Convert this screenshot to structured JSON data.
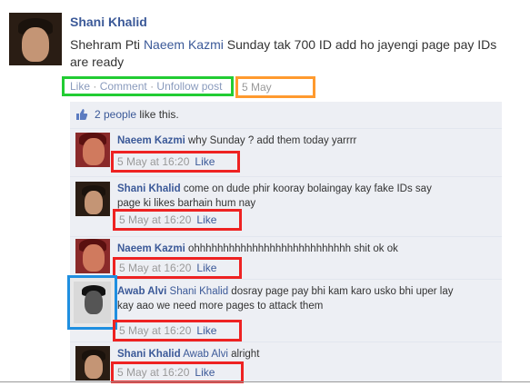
{
  "post": {
    "author": "Shani Khalid",
    "text_before": "Shehram Pti ",
    "mention": "Naeem Kazmi",
    "text_after": " Sunday tak 700 ID add ho jayengi page pay IDs are ready",
    "actions": {
      "like": "Like",
      "comment": "Comment",
      "unfollow": "Unfollow post",
      "separator": "·"
    },
    "date": "5 May"
  },
  "likes": {
    "count_link": "2 people",
    "suffix": " like this."
  },
  "comments": [
    {
      "author": "Naeem Kazmi",
      "mention": "",
      "text": "why Sunday ? add them today yarrrr",
      "time": "5 May at 16:20",
      "like": "Like"
    },
    {
      "author": "Shani Khalid",
      "mention": "",
      "text": "come on dude phir kooray bolaingay kay fake IDs say page ki likes barhain hum nay",
      "time": "5 May at 16:20",
      "like": "Like"
    },
    {
      "author": "Naeem Kazmi",
      "mention": "",
      "text": "ohhhhhhhhhhhhhhhhhhhhhhhhhhh shit ok ok",
      "time": "5 May at 16:20",
      "like": "Like"
    },
    {
      "author": "Awab Alvi",
      "mention": "Shani Khalid",
      "text": " dosray page pay bhi kam karo usko bhi uper lay kay aao we need more pages to attack them",
      "time": "5 May at 16:20",
      "like": "Like"
    },
    {
      "author": "Shani Khalid",
      "mention": "Awab Alvi",
      "text": " alright",
      "time": "5 May at 16:20",
      "like": "Like"
    }
  ],
  "colors": {
    "link": "#3b5998",
    "actions_highlight": "#22cc33",
    "date_highlight": "#ff9a2e",
    "time_highlight": "#ee2222",
    "avatar_highlight": "#1f8fe0",
    "comments_bg": "#edeff4"
  }
}
